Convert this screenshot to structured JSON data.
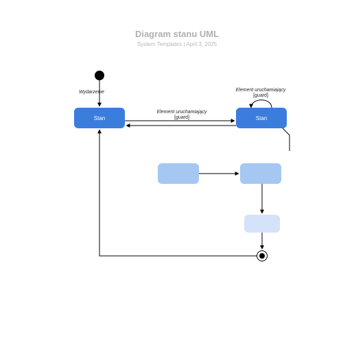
{
  "header": {
    "title": "Diagram stanu UML",
    "subtitle_left": "System Templates",
    "subtitle_sep": "  |  ",
    "subtitle_right": "April 3, 2025"
  },
  "labels": {
    "event": "Wydarzenie",
    "trigger_top": "Element uruchamiający",
    "guard_top": "[guard]",
    "trigger_mid": "Element uruchamiający",
    "guard_mid": "[guard]"
  },
  "states": {
    "left": "Stan",
    "right": "Stan"
  },
  "colors": {
    "dark": "#3b7ddd",
    "mid": "#a5c7f2",
    "light": "#d4e3f9"
  }
}
